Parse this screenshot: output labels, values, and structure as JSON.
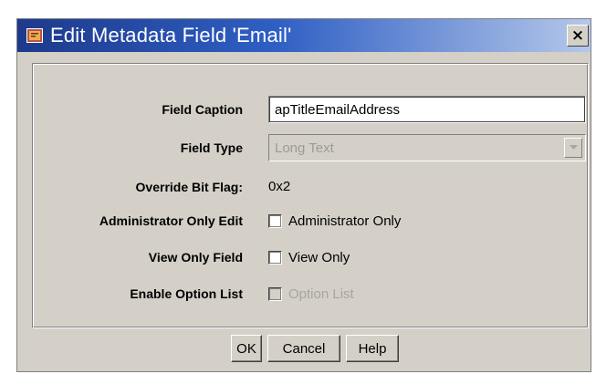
{
  "window": {
    "title": "Edit Metadata Field 'Email'",
    "title_icon": "metadata-form-icon",
    "close_label": "×"
  },
  "form": {
    "field_caption": {
      "label": "Field Caption",
      "value": "apTitleEmailAddress"
    },
    "field_type": {
      "label": "Field Type",
      "selected": "Long Text",
      "enabled": false
    },
    "override_bit_flag": {
      "label": "Override Bit Flag:",
      "value": "0x2"
    },
    "administrator_only_edit": {
      "label": "Administrator Only Edit",
      "checkbox_label": "Administrator Only",
      "checked": false,
      "enabled": true
    },
    "view_only_field": {
      "label": "View Only Field",
      "checkbox_label": "View Only",
      "checked": false,
      "enabled": true
    },
    "enable_option_list": {
      "label": "Enable Option List",
      "checkbox_label": "Option List",
      "checked": false,
      "enabled": false
    }
  },
  "buttons": {
    "ok": "OK",
    "cancel": "Cancel",
    "help": "Help"
  },
  "colors": {
    "titlebar_start": "#1d3a8c",
    "titlebar_end": "#b5c8ea",
    "dialog_bg": "#d4d0c8",
    "disabled_text": "#a8a59f"
  }
}
